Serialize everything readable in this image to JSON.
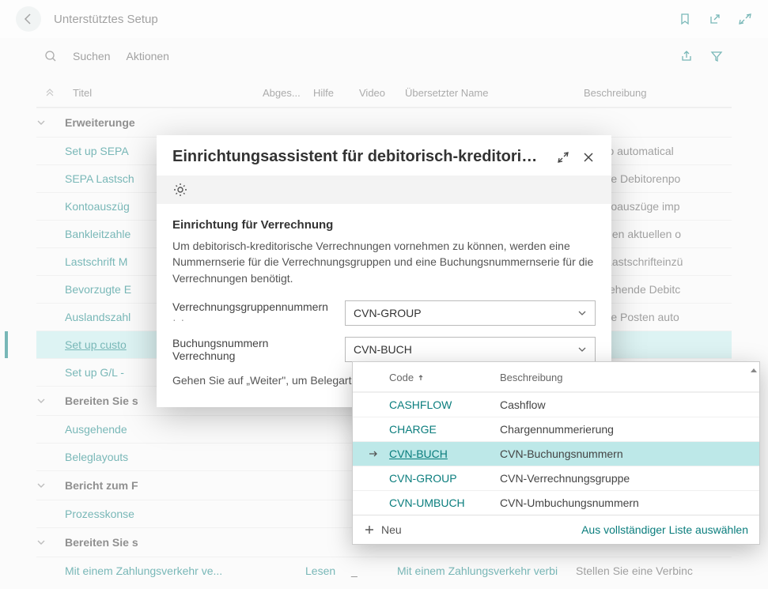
{
  "header": {
    "page_title": "Unterstütztes Setup"
  },
  "toolbar": {
    "search_label": "Suchen",
    "actions_label": "Aktionen"
  },
  "columns": {
    "title": "Titel",
    "completed": "Abges...",
    "help": "Hilfe",
    "video": "Video",
    "translated": "Übersetzter Name",
    "description": "Beschreibung"
  },
  "groups": [
    {
      "label": "Erweiterunge",
      "rows": [
        {
          "title": "Set up SEPA ",
          "desc": "order to automatical",
          "help": true
        },
        {
          "title": "SEPA Lastsch",
          "desc": "m fällige Debitorenpo",
          "help": true
        },
        {
          "title": "Kontoauszüg",
          "desc": "m Kontoauszüge imp",
          "help": true
        },
        {
          "title": "Bankleitzahle",
          "desc": "m mit den aktuellen o",
          "help": true
        },
        {
          "title": "Lastschrift M",
          "desc": "m mit Lastschrifteinzü",
          "help": true
        },
        {
          "title": "Bevorzugte E",
          "desc": "m bestehende Debitc",
          "help": true
        },
        {
          "title": "Auslandszahl",
          "desc": "m fällige Posten auto",
          "help": true
        },
        {
          "title": "Set up custo",
          "desc": "",
          "highlight": true,
          "help": true
        },
        {
          "title": "Set up G/L - ",
          "desc": "",
          "help": true
        }
      ]
    },
    {
      "label": "Bereiten Sie s",
      "rows": [
        {
          "title": "Ausgehende",
          "desc": ""
        },
        {
          "title": "Beleglayouts",
          "desc": ""
        }
      ]
    },
    {
      "label": "Bericht zum F",
      "rows": [
        {
          "title": "Prozesskonse",
          "desc": ""
        }
      ]
    },
    {
      "label": "Bereiten Sie s",
      "rows": [
        {
          "title": "Mit einem Zahlungsverkehr ve...",
          "help_text": "Lesen",
          "translated": "Mit einem Zahlungsverkehr verbi",
          "desc": "Stellen Sie eine Verbinc"
        }
      ]
    }
  ],
  "modal": {
    "title": "Einrichtungsassistent für debitorisch-kreditorisc…",
    "section_title": "Einrichtung für Verrechnung",
    "section_desc": "Um debitorisch-kreditorische Verrechnungen vornehmen zu können, werden eine Nummernserie für die Verrechnungsgruppen und eine Buchungsnummernserie für die Verrechnungen benötigt.",
    "field1_label": "Verrechnungsgruppennummern",
    "field1_value": "CVN-GROUP",
    "field2_label": "Buchungsnummern Verrechnung",
    "field2_value": "CVN-BUCH",
    "continue_text": "Gehen Sie auf „Weiter\", um Belegart festzulegen."
  },
  "dropdown": {
    "col_code": "Code",
    "col_desc": "Beschreibung",
    "rows": [
      {
        "code": "CASHFLOW",
        "desc": "Cashflow"
      },
      {
        "code": "CHARGE",
        "desc": "Chargennummerierung"
      },
      {
        "code": "CVN-BUCH",
        "desc": "CVN-Buchungsnummern",
        "selected": true
      },
      {
        "code": "CVN-GROUP",
        "desc": "CVN-Verrechnungsgruppe"
      },
      {
        "code": "CVN-UMBUCH",
        "desc": "CVN-Umbuchungsnummern"
      }
    ],
    "new_label": "Neu",
    "full_list_label": "Aus vollständiger Liste auswählen"
  }
}
